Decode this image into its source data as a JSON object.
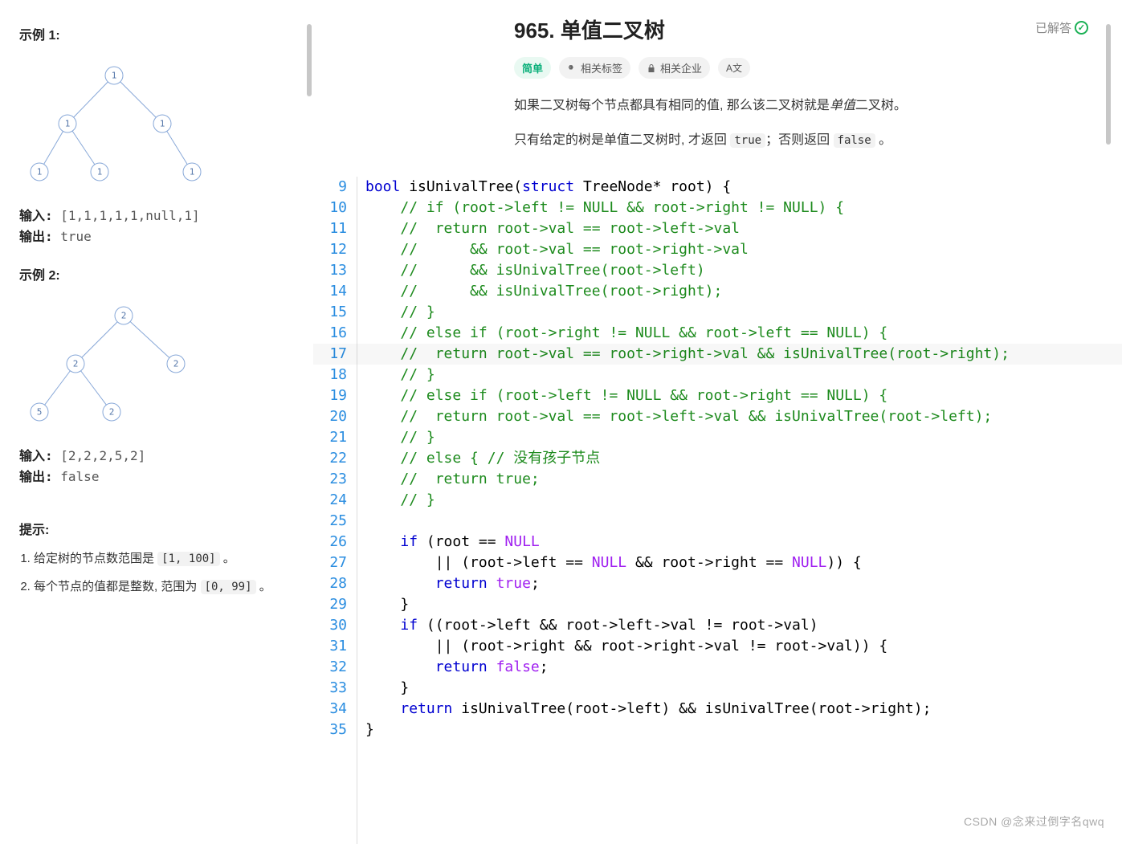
{
  "left": {
    "example1_title": "示例 1:",
    "ex1_input_label": "输入:",
    "ex1_input_value": "[1,1,1,1,1,null,1]",
    "ex1_output_label": "输出:",
    "ex1_output_value": "true",
    "example2_title": "示例 2:",
    "ex2_input_label": "输入:",
    "ex2_input_value": "[2,2,2,5,2]",
    "ex2_output_label": "输出:",
    "ex2_output_value": "false",
    "hints_title": "提示:",
    "hint1_prefix": "给定树的节点数范围是 ",
    "hint1_code": "[1, 100]",
    "hint1_suffix": " 。",
    "hint2_prefix": "每个节点的值都是整数, 范围为 ",
    "hint2_code": "[0, 99]",
    "hint2_suffix": " 。"
  },
  "header": {
    "title": "965. 单值二叉树",
    "solved_label": "已解答",
    "difficulty": "简单",
    "tag_label": "相关标签",
    "company_label": "相关企业",
    "translate_label": "A文"
  },
  "desc": {
    "p1_a": "如果二叉树每个节点都具有相同的值, 那么该二叉树就是",
    "p1_em": "单值",
    "p1_b": "二叉树。",
    "p2_a": "只有给定的树是单值二叉树时, 才返回 ",
    "p2_code1": "true",
    "p2_b": "；否则返回 ",
    "p2_code2": "false",
    "p2_c": " 。"
  },
  "tree1_nodes": [
    "1",
    "1",
    "1",
    "1",
    "1",
    "1"
  ],
  "tree2_nodes": [
    "2",
    "2",
    "2",
    "5",
    "2"
  ],
  "code_start_line": 9,
  "code_lines": [
    [
      [
        "kw",
        "bool"
      ],
      [
        "id",
        " isUnivalTree("
      ],
      [
        "kw",
        "struct"
      ],
      [
        "id",
        " TreeNode* root) {"
      ]
    ],
    [
      [
        "id",
        "    "
      ],
      [
        "cm",
        "// if (root->left != NULL && root->right != NULL) {"
      ]
    ],
    [
      [
        "id",
        "    "
      ],
      [
        "cm",
        "//  return root->val == root->left->val"
      ]
    ],
    [
      [
        "id",
        "    "
      ],
      [
        "cm",
        "//      && root->val == root->right->val"
      ]
    ],
    [
      [
        "id",
        "    "
      ],
      [
        "cm",
        "//      && isUnivalTree(root->left)"
      ]
    ],
    [
      [
        "id",
        "    "
      ],
      [
        "cm",
        "//      && isUnivalTree(root->right);"
      ]
    ],
    [
      [
        "id",
        "    "
      ],
      [
        "cm",
        "// }"
      ]
    ],
    [
      [
        "id",
        "    "
      ],
      [
        "cm",
        "// else if (root->right != NULL && root->left == NULL) {"
      ]
    ],
    [
      [
        "id",
        "    "
      ],
      [
        "cm",
        "//  return root->val == root->right->val && isUnivalTree(root->right);"
      ]
    ],
    [
      [
        "id",
        "    "
      ],
      [
        "cm",
        "// }"
      ]
    ],
    [
      [
        "id",
        "    "
      ],
      [
        "cm",
        "// else if (root->left != NULL && root->right == NULL) {"
      ]
    ],
    [
      [
        "id",
        "    "
      ],
      [
        "cm",
        "//  return root->val == root->left->val && isUnivalTree(root->left);"
      ]
    ],
    [
      [
        "id",
        "    "
      ],
      [
        "cm",
        "// }"
      ]
    ],
    [
      [
        "id",
        "    "
      ],
      [
        "cm",
        "// else { // 没有孩子节点"
      ]
    ],
    [
      [
        "id",
        "    "
      ],
      [
        "cm",
        "//  return true;"
      ]
    ],
    [
      [
        "id",
        "    "
      ],
      [
        "cm",
        "// }"
      ]
    ],
    [],
    [
      [
        "id",
        "    "
      ],
      [
        "kw",
        "if"
      ],
      [
        "id",
        " (root == "
      ],
      [
        "cn",
        "NULL"
      ]
    ],
    [
      [
        "id",
        "        || (root->left == "
      ],
      [
        "cn",
        "NULL"
      ],
      [
        "id",
        " && root->right == "
      ],
      [
        "cn",
        "NULL"
      ],
      [
        "id",
        ")) {"
      ]
    ],
    [
      [
        "id",
        "        "
      ],
      [
        "kw",
        "return"
      ],
      [
        "id",
        " "
      ],
      [
        "cn",
        "true"
      ],
      [
        "id",
        ";"
      ]
    ],
    [
      [
        "id",
        "    }"
      ]
    ],
    [
      [
        "id",
        "    "
      ],
      [
        "kw",
        "if"
      ],
      [
        "id",
        " ((root->left && root->left->val != root->val)"
      ]
    ],
    [
      [
        "id",
        "        || (root->right && root->right->val != root->val)) {"
      ]
    ],
    [
      [
        "id",
        "        "
      ],
      [
        "kw",
        "return"
      ],
      [
        "id",
        " "
      ],
      [
        "cn",
        "false"
      ],
      [
        "id",
        ";"
      ]
    ],
    [
      [
        "id",
        "    }"
      ]
    ],
    [
      [
        "id",
        "    "
      ],
      [
        "kw",
        "return"
      ],
      [
        "id",
        " isUnivalTree(root->left) && isUnivalTree(root->right);"
      ]
    ],
    [
      [
        "id",
        "}"
      ]
    ]
  ],
  "watermark": "CSDN @念来过倒字名qwq"
}
